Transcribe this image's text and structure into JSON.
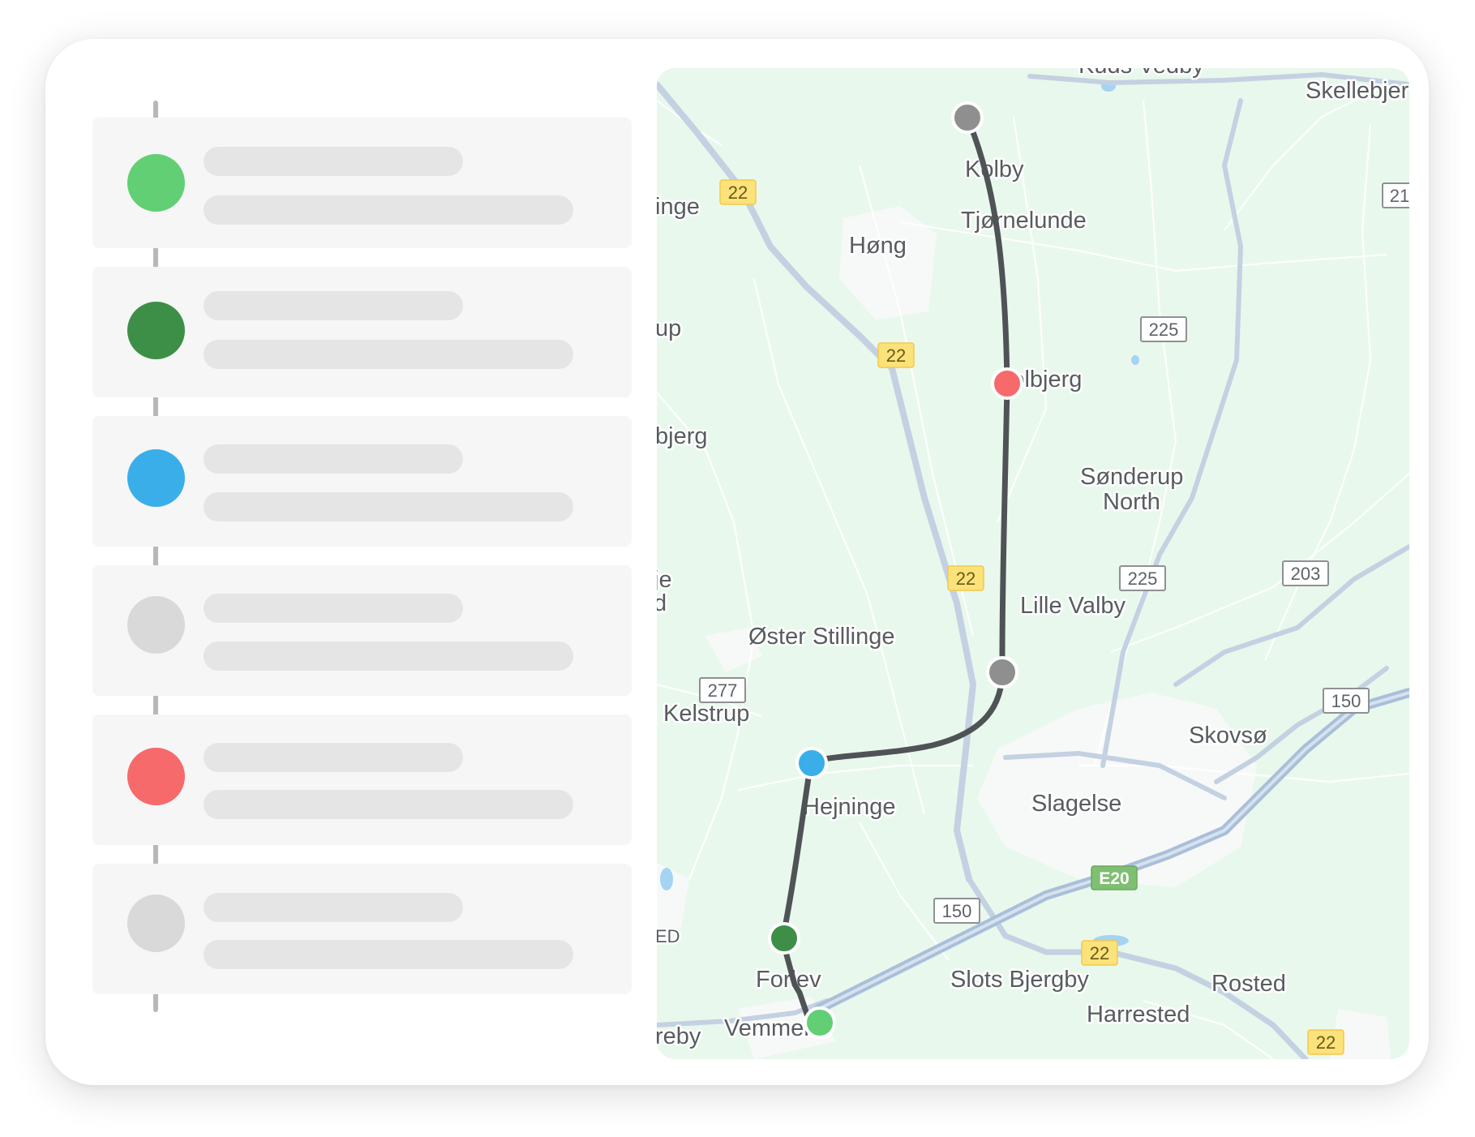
{
  "colors": {
    "green_light": "#62cf75",
    "green_dark": "#3d8f48",
    "blue": "#3aaee8",
    "red": "#f66a6c",
    "gray_stop": "#8f8f8f",
    "gray_pending": "#d9d9d9",
    "route": "#4f5356",
    "map_bg": "#e9f8ec"
  },
  "timeline": {
    "items": [
      {
        "dot_color": "#62cf75"
      },
      {
        "dot_color": "#3d8f48"
      },
      {
        "dot_color": "#3aaee8"
      },
      {
        "dot_color": "#d9d9d9"
      },
      {
        "dot_color": "#f66a6c"
      },
      {
        "dot_color": "#d9d9d9"
      }
    ]
  },
  "map": {
    "places": {
      "kuds_vedby": "Kuds Vedby",
      "skellebjerg": "Skellebjer",
      "kolby": "Kolby",
      "tjornelunde": "Tjørnelunde",
      "hong": "Høng",
      "inge": "inge",
      "up": "up",
      "solbjerg": "Solbjerg",
      "bjerg": "bjerg",
      "sonderup": "Sønderup",
      "north": "North",
      "lille_valby": "Lille Valby",
      "oster_stillinge": "Øster Stillinge",
      "je": "je",
      "d": "d",
      "kelstrup": "Kelstrup",
      "skovso": "Skovsø",
      "hejninge": "Hejninge",
      "slagelse": "Slagelse",
      "ed": "ED",
      "forlev": "Forlev",
      "slots_bjergby": "Slots Bjergby",
      "rosted": "Rosted",
      "harrested": "Harrested",
      "reby": "reby",
      "vemmelev": "Vemmelev"
    },
    "shields": {
      "r22": "22",
      "r21": "21",
      "r225": "225",
      "r203": "203",
      "r277": "277",
      "r150": "150",
      "e20": "E20"
    },
    "route_stops": [
      {
        "label": "start",
        "color": "#8f8f8f"
      },
      {
        "label": "stop-2",
        "color": "#f66a6c"
      },
      {
        "label": "stop-3",
        "color": "#8f8f8f"
      },
      {
        "label": "stop-4",
        "color": "#3aaee8"
      },
      {
        "label": "stop-5",
        "color": "#3d8f48"
      },
      {
        "label": "end",
        "color": "#62cf75"
      }
    ]
  }
}
